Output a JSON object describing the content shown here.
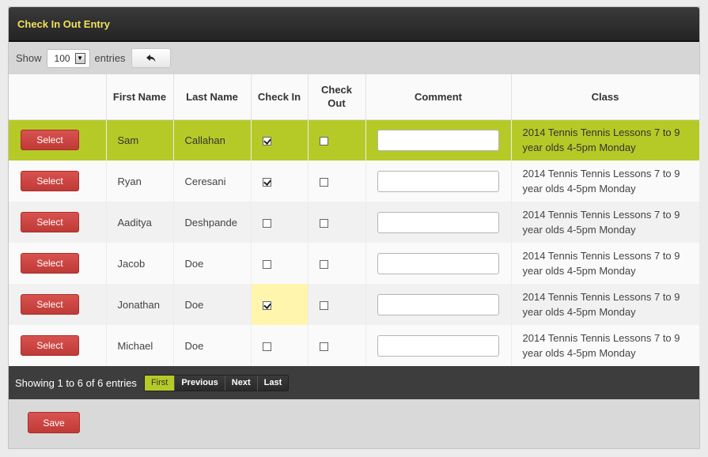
{
  "panel": {
    "title": "Check In Out Entry"
  },
  "toolbar": {
    "show_label": "Show",
    "entries_value": "100",
    "entries_label": "entries",
    "back_icon": "undo-arrow-icon"
  },
  "table": {
    "headers": [
      "",
      "First Name",
      "Last Name",
      "Check In",
      "Check Out",
      "Comment",
      "Class"
    ],
    "select_label": "Select",
    "rows": [
      {
        "first": "Sam",
        "last": "Callahan",
        "check_in": true,
        "check_out": false,
        "comment": "",
        "class": "2014 Tennis Tennis Lessons 7 to 9 year olds 4-5pm Monday"
      },
      {
        "first": "Ryan",
        "last": "Ceresani",
        "check_in": true,
        "check_out": false,
        "comment": "",
        "class": "2014 Tennis Tennis Lessons 7 to 9 year olds 4-5pm Monday"
      },
      {
        "first": "Aaditya",
        "last": "Deshpande",
        "check_in": false,
        "check_out": false,
        "comment": "",
        "class": "2014 Tennis Tennis Lessons 7 to 9 year olds 4-5pm Monday"
      },
      {
        "first": "Jacob",
        "last": "Doe",
        "check_in": false,
        "check_out": false,
        "comment": "",
        "class": "2014 Tennis Tennis Lessons 7 to 9 year olds 4-5pm Monday"
      },
      {
        "first": "Jonathan",
        "last": "Doe",
        "check_in": true,
        "check_out": false,
        "comment": "",
        "class": "2014 Tennis Tennis Lessons 7 to 9 year olds 4-5pm Monday"
      },
      {
        "first": "Michael",
        "last": "Doe",
        "check_in": false,
        "check_out": false,
        "comment": "",
        "class": "2014 Tennis Tennis Lessons 7 to 9 year olds 4-5pm Monday"
      }
    ]
  },
  "footer": {
    "info": "Showing 1 to 6 of 6 entries",
    "pager": [
      "First",
      "Previous",
      "Next",
      "Last"
    ]
  },
  "actions": {
    "save_label": "Save"
  },
  "colors": {
    "accent": "#b6ca27",
    "title_text": "#f0e060",
    "button_red": "#c9443f",
    "highlight": "#fff5ad"
  }
}
